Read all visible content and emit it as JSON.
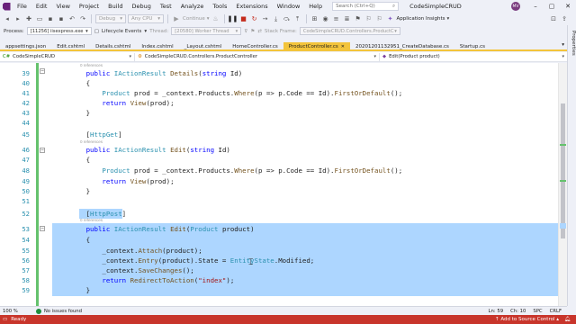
{
  "menubar": {
    "items": [
      "File",
      "Edit",
      "View",
      "Project",
      "Build",
      "Debug",
      "Test",
      "Analyze",
      "Tools",
      "Extensions",
      "Window",
      "Help"
    ],
    "search_placeholder": "Search (Ctrl+Q)",
    "app_title": "CodeSimpleCRUD",
    "avatar_initials": "MV"
  },
  "toolbar": {
    "config": "Debug",
    "platform": "Any CPU",
    "continue_label": "Continue",
    "app_insights": "Application Insights"
  },
  "procbar": {
    "process_label": "Process:",
    "process_value": "[11256] iisexpress.exe",
    "lifecycle_label": "Lifecycle Events",
    "thread_label": "Thread:",
    "thread_value": "[20580] Worker Thread",
    "stackframe_label": "Stack Frame:",
    "stackframe_value": "CodeSimpleCRUD.Controllers.ProductCon"
  },
  "tabs": [
    "appsettings.json",
    "Edit.cshtml",
    "Details.cshtml",
    "Index.cshtml",
    "_Layout.cshtml",
    "HomeController.cs",
    "ProductController.cs",
    "20201201132951_CreateDatabase.cs",
    "Startup.cs"
  ],
  "active_tab_index": 6,
  "navbar": {
    "project": "CodeSimpleCRUD",
    "class": "CodeSimpleCRUD.Controllers.ProductController",
    "member": "Edit(Product product)"
  },
  "rail": {
    "label": "Properties"
  },
  "editor": {
    "references_label": "0 references",
    "line_numbers": [
      "39",
      "40",
      "41",
      "42",
      "43",
      "44",
      "45",
      "46",
      "47",
      "48",
      "49",
      "50",
      "51",
      "52",
      "53",
      "54",
      "55",
      "56",
      "57",
      "58",
      "59"
    ]
  },
  "edstatus": {
    "zoom": "100 %",
    "issues": "No issues found",
    "line": "Ln: 59",
    "col": "Ch: 10",
    "mode": "SPC",
    "eol": "CRLF"
  },
  "statusbar": {
    "state": "Ready",
    "source_control": "Add to Source Control"
  }
}
